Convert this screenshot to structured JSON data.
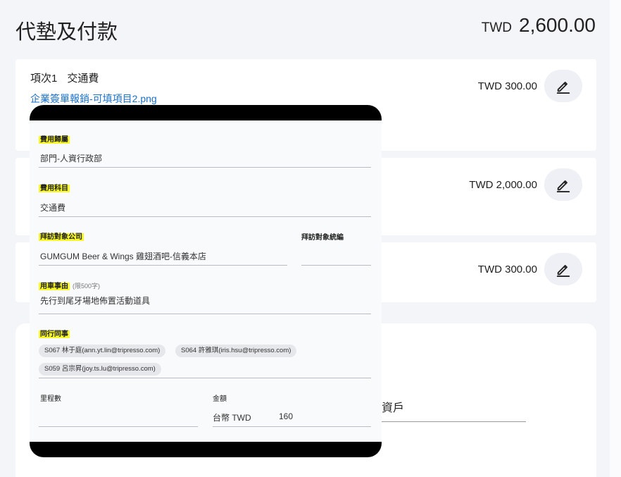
{
  "header": {
    "title": "代墊及付款",
    "total_currency": "TWD",
    "total_amount": "2,600.00"
  },
  "items": [
    {
      "title_no": "項次1",
      "title_type": "交通費",
      "attachment": "企業簽單報銷-可填項目2.png",
      "amount": "TWD 300.00"
    },
    {
      "amount": "TWD 2,000.00"
    },
    {
      "amount": "TWD 300.00"
    }
  ],
  "payment_section": {
    "partial_text": "資戶"
  },
  "overlay_form": {
    "expense_owner_label": "費用歸屬",
    "expense_owner_value": "部門-人資行政部",
    "expense_category_label": "費用科目",
    "expense_category_value": "交通費",
    "visit_company_label": "拜訪對象公司",
    "visit_company_value": "GUMGUM Beer & Wings 雞翅酒吧-信義本店",
    "visit_taxid_label": "拜訪對象統編",
    "reason_label": "用車事由",
    "reason_note": "(限500字)",
    "reason_value": "先行到尾牙場地佈置活動道具",
    "colleagues_label": "同行同事",
    "colleagues": [
      "S067 林于庭(ann.yt.lin@tripresso.com)",
      "S064 許雅琪(iris.hsu@tripresso.com)",
      "S059 呂宗昇(joy.ts.lu@tripresso.com)"
    ],
    "mileage_label": "里程數",
    "amount_label": "金額",
    "amount_currency": "台幣 TWD",
    "amount_value": "160"
  },
  "colors": {
    "link": "#1a6fc9",
    "highlight": "#f7f72a",
    "edit_button_bg": "#eef0f5"
  },
  "icons": {
    "edit": "pencil-icon"
  }
}
